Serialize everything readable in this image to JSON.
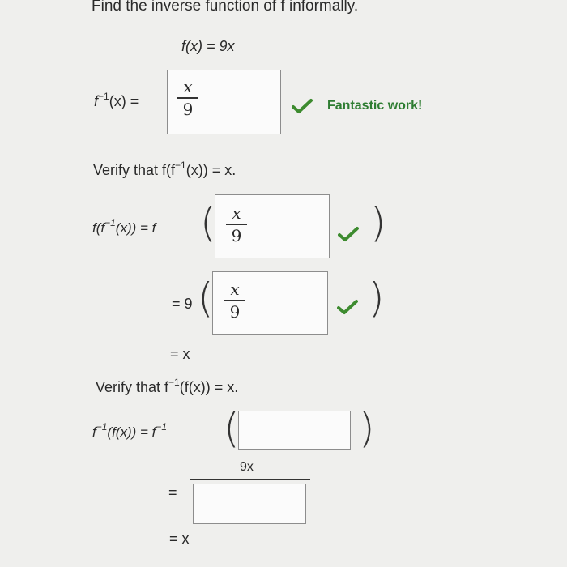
{
  "instruction": "Find the inverse function of f informally.",
  "given": {
    "lhs": "f(x) = 9x"
  },
  "inverse": {
    "lhs_f": "f",
    "lhs_sup": "−1",
    "lhs_tail": "(x) =",
    "answer_num": "x",
    "answer_den": "9",
    "feedback": "Fantastic work!"
  },
  "verify1": {
    "heading_pre": "Verify that f(f",
    "heading_sup": "−1",
    "heading_post": "(x)) = x.",
    "row1_pre": "f(f",
    "row1_sup": "−1",
    "row1_post": "(x))  =  f",
    "row1_num": "x",
    "row1_den": "9",
    "row2_pre": "=  9",
    "row2_num": "x",
    "row2_den": "9",
    "row3": "= x"
  },
  "verify2": {
    "heading_pre": "Verify that f",
    "heading_sup": "−1",
    "heading_post": "(f(x)) = x.",
    "row1_a": "f",
    "row1_sup": "−1",
    "row1_b": "(f(x))  =  f",
    "row1_sup2": "−1",
    "row1_value": "",
    "row2_eq": "=",
    "row2_num": "9x",
    "row2_den_value": "",
    "row3": "= x"
  },
  "colors": {
    "check": "#3d8b2f",
    "feedback": "#2e7d32",
    "background": "#efefed"
  }
}
